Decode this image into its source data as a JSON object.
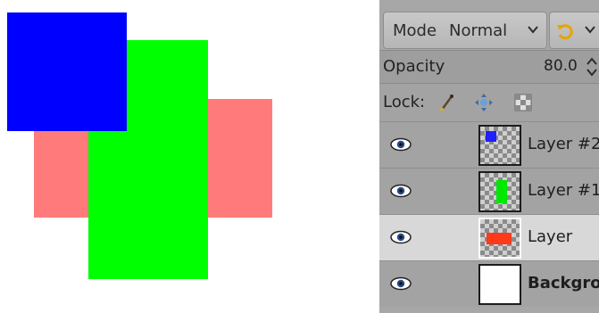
{
  "canvas": {
    "shapes": [
      {
        "name": "red-rectangle",
        "color": "#ff7b7b"
      },
      {
        "name": "green-rectangle",
        "color": "#00ff00"
      },
      {
        "name": "blue-square",
        "color": "#0000ff"
      }
    ]
  },
  "layers_panel": {
    "mode_label": "Mode",
    "mode_value": "Normal",
    "opacity_label": "Opacity",
    "opacity_value": "80.0",
    "lock_label": "Lock:",
    "layers": [
      {
        "name": "Layer #2",
        "visible": true,
        "selected": false,
        "bold": false,
        "thumb_color": "#1f1fff"
      },
      {
        "name": "Layer #1",
        "visible": true,
        "selected": false,
        "bold": false,
        "thumb_color": "#00e800"
      },
      {
        "name": "Layer",
        "visible": true,
        "selected": true,
        "bold": false,
        "thumb_color": "#ff3a1a"
      },
      {
        "name": "Background",
        "visible": true,
        "selected": false,
        "bold": true,
        "thumb_color": "#ffffff"
      }
    ]
  }
}
